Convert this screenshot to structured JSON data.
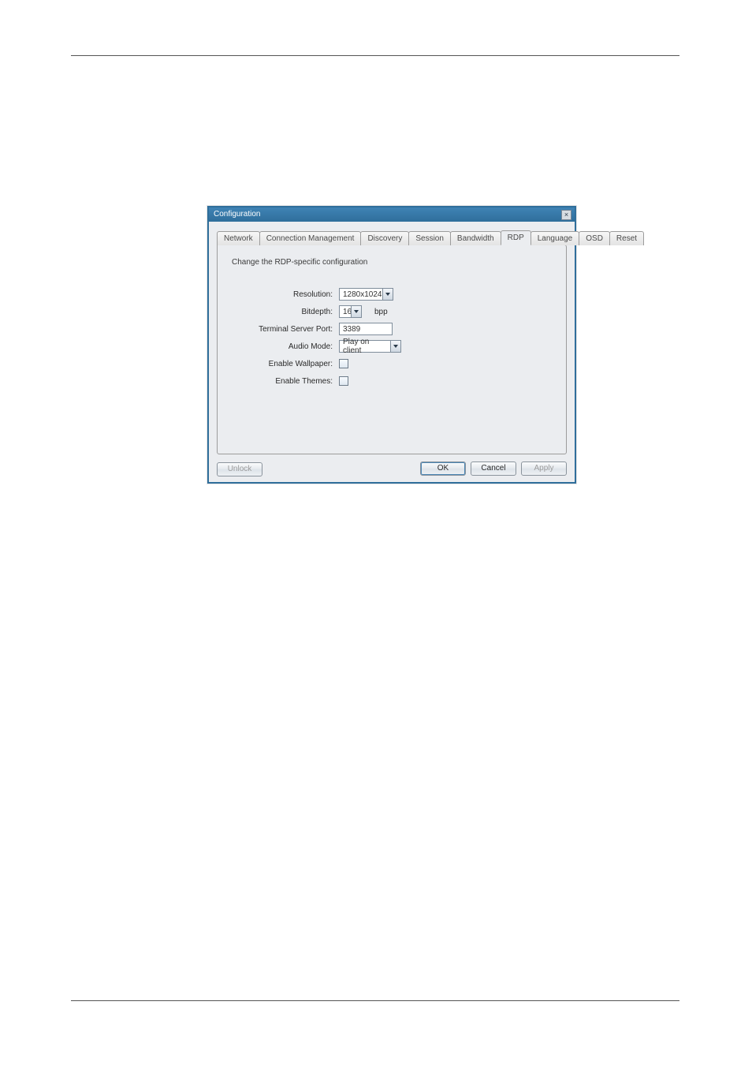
{
  "dialog": {
    "title": "Configuration",
    "close_icon": "×"
  },
  "tabs": {
    "network": "Network",
    "connection_management": "Connection Management",
    "discovery": "Discovery",
    "session": "Session",
    "bandwidth": "Bandwidth",
    "rdp": "RDP",
    "language": "Language",
    "osd": "OSD",
    "reset": "Reset",
    "active": "rdp"
  },
  "panel": {
    "description": "Change the RDP-specific configuration"
  },
  "form": {
    "resolution": {
      "label": "Resolution:",
      "value": "1280x1024"
    },
    "bitdepth": {
      "label": "Bitdepth:",
      "value": "16",
      "suffix": "bpp"
    },
    "port": {
      "label": "Terminal Server Port:",
      "value": "3389"
    },
    "audio": {
      "label": "Audio Mode:",
      "value": "Play on client"
    },
    "wallpaper": {
      "label": "Enable Wallpaper:",
      "checked": false
    },
    "themes": {
      "label": "Enable Themes:",
      "checked": false
    }
  },
  "buttons": {
    "unlock": "Unlock",
    "ok": "OK",
    "cancel": "Cancel",
    "apply": "Apply"
  }
}
